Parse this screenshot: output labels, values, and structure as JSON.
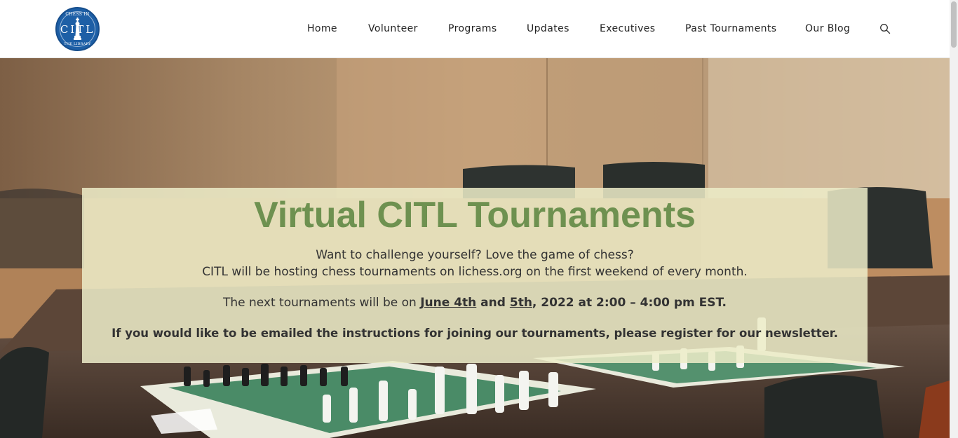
{
  "logo": {
    "arc_top": "CHESS IN",
    "letters": "CITL",
    "arc_bottom": "THE LIBRARY"
  },
  "nav": {
    "items": [
      "Home",
      "Volunteer",
      "Programs",
      "Updates",
      "Executives",
      "Past Tournaments",
      "Our Blog"
    ],
    "search_icon": "search-icon"
  },
  "hero": {
    "headline": "Virtual CITL Tournaments",
    "line1": "Want to challenge yourself? Love the game of chess?",
    "line2": "CITL will be hosting chess tournaments on lichess.org on the first weekend of every month.",
    "line3_prefix": "The next tournaments will be on ",
    "line3_date1": "June 4th",
    "line3_and": " and ",
    "line3_date2": "5th",
    "line3_rest": ", 2022 at 2:00 – 4:00 pm",
    "line3_tz": " EST.",
    "line4": "If you would like to be emailed the instructions for joining our tournaments, please register for our newsletter."
  },
  "colors": {
    "headline": "#6e9150",
    "logo_blue": "#1d5fa6",
    "panel": "#ececc8"
  }
}
